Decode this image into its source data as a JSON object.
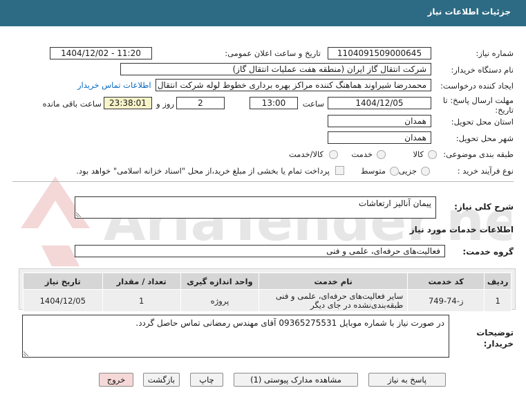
{
  "header": {
    "title": "جزئیات اطلاعات نیاز"
  },
  "fields": {
    "need_number_label": "شماره نیاز:",
    "need_number": "1104091509000645",
    "announce_label": "تاریخ و ساعت اعلان عمومی:",
    "announce_value": "1404/12/02 - 11:20",
    "buyer_label": "نام دستگاه خریدار:",
    "buyer_value": "شرکت انتقال گاز ایران (منطقه هفت عملیات انتقال گاز)",
    "creator_label": "ایجاد کننده درخواست:",
    "creator_value": "محمدرضا شیراوند هماهنگ کننده مراکز بهره برداری خطوط لوله  شرکت انتقال گا",
    "contact_link": "اطلاعات تماس خریدار",
    "deadline_label": "مهلت ارسال پاسخ: تا تاریخ:",
    "deadline_date": "1404/12/05",
    "time_label": "ساعت",
    "deadline_time": "13:00",
    "days_value": "2",
    "days_label": "روز و",
    "remaining_time": "23:38:01",
    "remaining_label": "ساعت باقی مانده",
    "province_label": "استان محل تحویل:",
    "province_value": "همدان",
    "city_label": "شهر محل تحویل:",
    "city_value": "همدان",
    "category_label": "طبقه بندی موضوعی:",
    "category_options": [
      "کالا",
      "خدمت",
      "کالا/خدمت"
    ],
    "process_label": "نوع فرآیند خرید :",
    "process_options": [
      "جزیی",
      "متوسط"
    ],
    "payment_note": "پرداخت تمام یا بخشی از مبلغ خرید،از محل \"اسناد خزانه اسلامی\" خواهد بود."
  },
  "summary": {
    "label": "شرح کلی نیاز:",
    "value": "پیمان آنالیز ارتعاشات"
  },
  "services": {
    "section_title": "اطلاعات خدمات مورد نیاز",
    "group_label": "گروه خدمت:",
    "group_value": "فعالیت‌های حرفه‌ای، علمی و فنی",
    "columns": [
      "ردیف",
      "کد خدمت",
      "نام خدمت",
      "واحد اندازه گیری",
      "تعداد / مقدار",
      "تاریخ نیاز"
    ],
    "rows": [
      {
        "index": "1",
        "code": "ز-74-749",
        "name": "سایر فعالیت‌های حرفه‌ای، علمی و فنی طبقه‌بندی‌نشده در جای دیگر",
        "unit": "پروژه",
        "qty": "1",
        "date": "1404/12/05"
      }
    ]
  },
  "buyer_notes": {
    "label": "توضیحات خریدار:",
    "value": "در صورت نیاز با شماره موبایل 09365275531 آقای مهندس رمضانی تماس حاصل گردد."
  },
  "buttons": {
    "reply": "پاسخ به نیاز",
    "attachments": "مشاهده مدارک پیوستی (1)",
    "print": "چاپ",
    "back": "بازگشت",
    "exit": "خروج"
  },
  "watermark": {
    "text": "AriaTender.net"
  },
  "colors": {
    "header": "#2d6b84",
    "link": "#0a6ac2",
    "highlight_field": "#f7f3c8",
    "exit_button": "#f6d8d8"
  }
}
